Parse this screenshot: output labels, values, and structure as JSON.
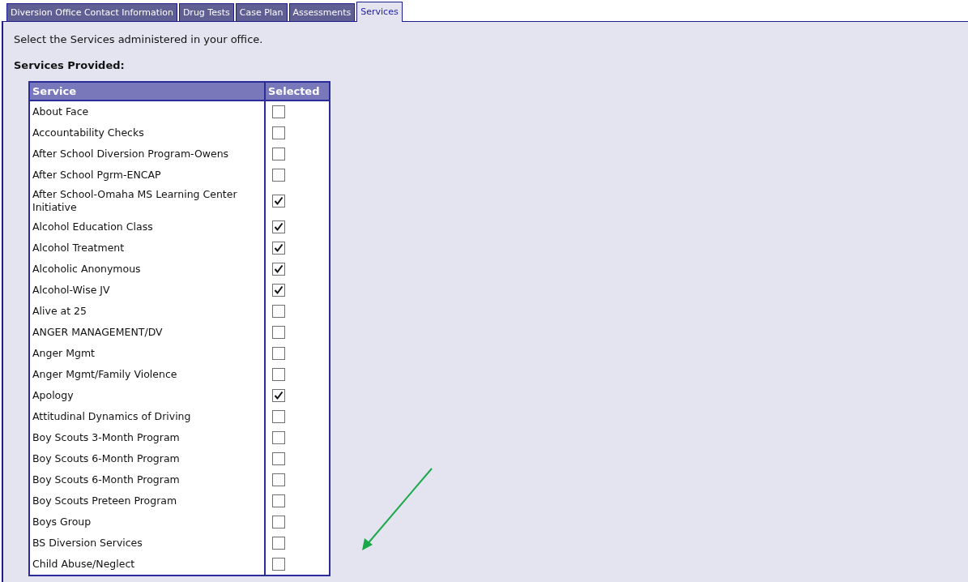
{
  "tabs": [
    {
      "label": "Diversion Office Contact Information",
      "selected": false
    },
    {
      "label": "Drug Tests",
      "selected": false
    },
    {
      "label": "Case Plan",
      "selected": false
    },
    {
      "label": "Assessments",
      "selected": false
    },
    {
      "label": "Services",
      "selected": true
    }
  ],
  "intro": "Select the Services administered in your office.",
  "section_title": "Services Provided:",
  "table": {
    "columns": [
      "Service",
      "Selected"
    ],
    "rows": [
      {
        "service": "About Face",
        "checked": false
      },
      {
        "service": "Accountability Checks",
        "checked": false
      },
      {
        "service": "After School Diversion Program-Owens",
        "checked": false
      },
      {
        "service": "After School Pgrm-ENCAP",
        "checked": false
      },
      {
        "service": "After School-Omaha MS Learning Center Initiative",
        "checked": true
      },
      {
        "service": "Alcohol Education Class",
        "checked": true
      },
      {
        "service": "Alcohol Treatment",
        "checked": true
      },
      {
        "service": "Alcoholic Anonymous",
        "checked": true
      },
      {
        "service": "Alcohol-Wise JV",
        "checked": true
      },
      {
        "service": "Alive at 25",
        "checked": false
      },
      {
        "service": "ANGER MANAGEMENT/DV",
        "checked": false
      },
      {
        "service": "Anger Mgmt",
        "checked": false
      },
      {
        "service": "Anger Mgmt/Family Violence",
        "checked": false
      },
      {
        "service": "Apology",
        "checked": true
      },
      {
        "service": "Attitudinal Dynamics of Driving",
        "checked": false
      },
      {
        "service": "Boy Scouts 3-Month Program",
        "checked": false
      },
      {
        "service": "Boy Scouts 6-Month Program",
        "checked": false
      },
      {
        "service": "Boy Scouts 6-Month Program",
        "checked": false
      },
      {
        "service": "Boy Scouts Preteen Program",
        "checked": false
      },
      {
        "service": "Boys Group",
        "checked": false
      },
      {
        "service": "BS Diversion Services",
        "checked": false
      },
      {
        "service": "Child Abuse/Neglect",
        "checked": false
      }
    ]
  }
}
